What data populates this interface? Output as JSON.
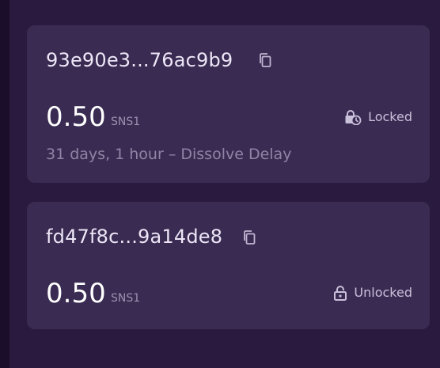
{
  "neurons": [
    {
      "id": "93e90e3...76ac9b9",
      "amount": "0.50",
      "token": "SNS1",
      "state": "Locked",
      "state_icon": "locked-clock-icon",
      "dissolve_delay": "31 days, 1 hour – Dissolve Delay"
    },
    {
      "id": "fd47f8c...9a14de8",
      "amount": "0.50",
      "token": "SNS1",
      "state": "Unlocked",
      "state_icon": "unlocked-icon"
    }
  ],
  "icons": {
    "copy": "copy-icon"
  },
  "colors": {
    "background": "#2b1a3f",
    "card": "#3a2b52",
    "primary_text": "#ffffff",
    "secondary_text": "#9b91b0"
  }
}
